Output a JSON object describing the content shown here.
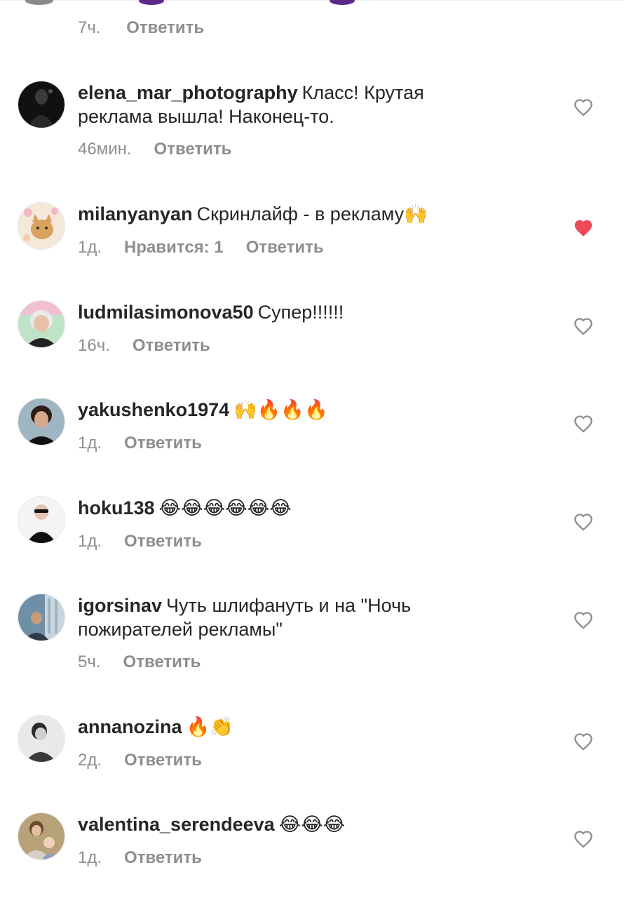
{
  "top_meta": {
    "time": "7ч.",
    "reply": "Ответить"
  },
  "comments": [
    {
      "username": "elena_mar_photography",
      "text": "Класс! Крутая реклама вышла! Наконец-то.",
      "time": "46мин.",
      "likes": "",
      "reply": "Ответить",
      "liked": false
    },
    {
      "username": "milanyanyan",
      "text": "Скринлайф - в рекламу🙌",
      "time": "1д.",
      "likes": "Нравится: 1",
      "reply": "Ответить",
      "liked": true
    },
    {
      "username": "ludmilasimonova50",
      "text": "Супер!!!!!!",
      "time": "16ч.",
      "likes": "",
      "reply": "Ответить",
      "liked": false
    },
    {
      "username": "yakushenko1974",
      "text": "🙌🔥🔥🔥",
      "time": "1д.",
      "likes": "",
      "reply": "Ответить",
      "liked": false
    },
    {
      "username": "hoku138",
      "text": "😂😂😂😂😂😂",
      "time": "1д.",
      "likes": "",
      "reply": "Ответить",
      "liked": false
    },
    {
      "username": "igorsinav",
      "text": "Чуть шлифануть и на \"Ночь пожирателей рекламы\"",
      "time": "5ч.",
      "likes": "",
      "reply": "Ответить",
      "liked": false
    },
    {
      "username": "annanozina",
      "text": "🔥👏",
      "time": "2д.",
      "likes": "",
      "reply": "Ответить",
      "liked": false
    },
    {
      "username": "valentina_serendeeva",
      "text": "😂😂😂",
      "time": "1д.",
      "likes": "",
      "reply": "Ответить",
      "liked": false
    }
  ],
  "colors": {
    "text": "#262626",
    "meta": "#8e8e8e",
    "heart_outline": "#8e8e8e",
    "heart_liked": "#ed4956"
  },
  "icons": {
    "like": "heart-outline-icon",
    "liked": "heart-filled-icon"
  }
}
